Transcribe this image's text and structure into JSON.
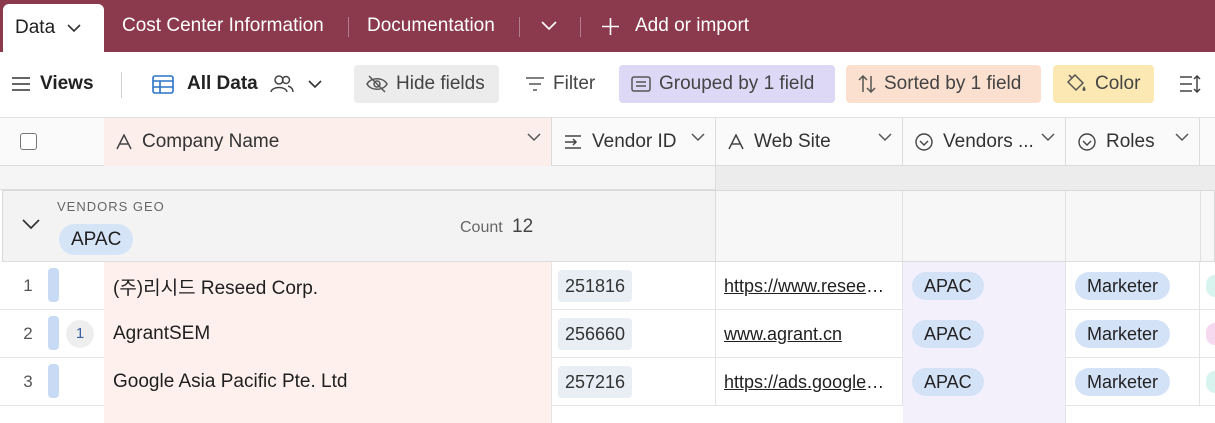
{
  "tabs": {
    "active": "Data",
    "items": [
      "Cost Center Information",
      "Documentation"
    ],
    "add_label": "Add or import"
  },
  "toolbar": {
    "views_label": "Views",
    "view_name": "All Data",
    "hide_fields": "Hide fields",
    "filter": "Filter",
    "grouped": "Grouped by 1 field",
    "sorted": "Sorted by 1 field",
    "color": "Color"
  },
  "columns": [
    "Company Name",
    "Vendor ID",
    "Web Site",
    "Vendors ...",
    "Roles"
  ],
  "group": {
    "field_label": "VENDORS GEO",
    "value": "APAC",
    "count_label": "Count",
    "count": "12"
  },
  "rows": [
    {
      "num": "1",
      "comments": "",
      "company": "(주)리시드 Reseed Corp.",
      "vendor_id": "251816",
      "web": "https://www.reseed.co.kr",
      "geo": "APAC",
      "role": "Marketer"
    },
    {
      "num": "2",
      "comments": "1",
      "company": "AgrantSEM",
      "vendor_id": "256660",
      "web": "www.agrant.cn",
      "geo": "APAC",
      "role": "Marketer"
    },
    {
      "num": "3",
      "comments": "",
      "company": "Google Asia Pacific Pte. Ltd",
      "vendor_id": "257216",
      "web": "https://ads.google.com",
      "geo": "APAC",
      "role": "Marketer"
    }
  ],
  "colors": {
    "tabbar": "#8a3a4c",
    "group_pill": "#d6e4f8",
    "name_column": "#fdf0ed",
    "geo_column": "#f3f0fb"
  },
  "icons": [
    "chevron-down-icon",
    "plus-icon",
    "hamburger-icon",
    "grid-view-icon",
    "people-icon",
    "eye-slash-icon",
    "filter-icon",
    "group-icon",
    "sort-icon",
    "paint-bucket-icon",
    "row-height-icon",
    "text-field-icon",
    "number-field-icon",
    "single-select-icon"
  ]
}
